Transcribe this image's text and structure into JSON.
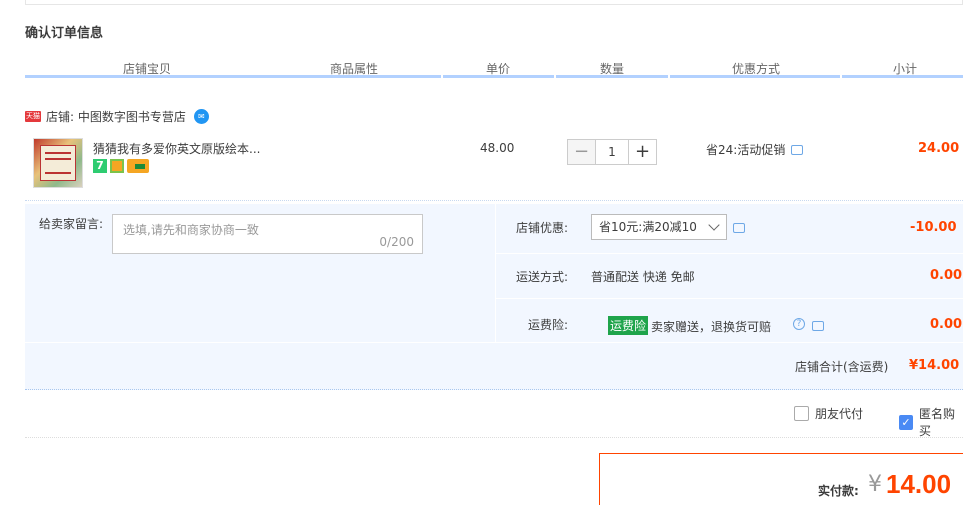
{
  "section_title": "确认订单信息",
  "columns": [
    "店铺宝贝",
    "商品属性",
    "单价",
    "数量",
    "优惠方式",
    "小计"
  ],
  "shop": {
    "tmall_icon": "tmall-logo",
    "label": "店铺: 中图数字图书专营店"
  },
  "item": {
    "name": "猜猜我有多爱你英文原版绘本...",
    "badge_7": "7",
    "price": "48.00",
    "quantity": "1",
    "minus": "−",
    "plus": "+",
    "promo": "省24:活动促销",
    "subtotal": "24.00"
  },
  "memo": {
    "label": "给卖家留言:",
    "placeholder": "选填,请先和商家协商一致",
    "count": "0/200"
  },
  "shop_discount": {
    "label": "店铺优惠:",
    "selected": "省10元:满20减10",
    "amount": "-10.00"
  },
  "shipping": {
    "label": "运送方式:",
    "value": "普通配送 快递 免邮",
    "amount": "0.00"
  },
  "insurance": {
    "label": "运费险:",
    "tag": "运费险",
    "text": "卖家赠送，退换货可赔",
    "amount": "0.00"
  },
  "shop_total": {
    "label": "店铺合计(含运费)",
    "value": "¥14.00"
  },
  "options": {
    "friend_pay": "朋友代付",
    "anonymous": "匿名购买"
  },
  "payment": {
    "label": "实付款:",
    "currency": "¥",
    "value": "14.00"
  },
  "colors": {
    "accent": "#ff4400",
    "header_bar": "#b2d1ff",
    "panel_bg": "#f2f7ff"
  }
}
